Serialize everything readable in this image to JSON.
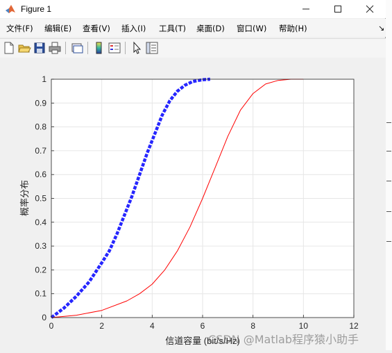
{
  "window": {
    "title": "Figure 1",
    "icon": "matlab-logo-icon"
  },
  "window_controls": {
    "minimize": "—",
    "maximize": "☐",
    "close": "✕"
  },
  "menu": {
    "items": [
      {
        "label": "文件(F)"
      },
      {
        "label": "编辑(E)"
      },
      {
        "label": "查看(V)"
      },
      {
        "label": "插入(I)"
      },
      {
        "label": "工具(T)"
      },
      {
        "label": "桌面(D)"
      },
      {
        "label": "窗口(W)"
      },
      {
        "label": "帮助(H)"
      }
    ],
    "overflow": "↘"
  },
  "toolbar": {
    "icons": [
      "new-figure-icon",
      "open-file-icon",
      "save-icon",
      "print-icon",
      "link-plot-icon",
      "colorbar-icon",
      "legend-icon",
      "pointer-icon",
      "property-editor-icon"
    ]
  },
  "colors": {
    "series_blue": "#0000ff",
    "series_red": "#ff0000",
    "grid": "#e6e6e6"
  },
  "chart_data": {
    "type": "line",
    "title": "",
    "xlabel": "信道容量 (bit/s/Hz)",
    "ylabel": "概率分布",
    "xlim": [
      0,
      12
    ],
    "ylim": [
      0,
      1
    ],
    "xticks": [
      0,
      2,
      4,
      6,
      8,
      10,
      12
    ],
    "yticks": [
      0,
      0.1,
      0.2,
      0.3,
      0.4,
      0.5,
      0.6,
      0.7,
      0.8,
      0.9,
      1
    ],
    "xtick_labels": [
      "0",
      "2",
      "4",
      "6",
      "8",
      "10",
      "12"
    ],
    "ytick_labels": [
      "0",
      "0.1",
      "0.2",
      "0.3",
      "0.4",
      "0.5",
      "0.6",
      "0.7",
      "0.8",
      "0.9",
      "1"
    ],
    "grid": true,
    "series": [
      {
        "color": "#0000ff",
        "style": "thick-dashed",
        "x": [
          0,
          0.5,
          1.0,
          1.5,
          2.0,
          2.3,
          2.6,
          2.9,
          3.2,
          3.5,
          3.8,
          4.1,
          4.4,
          4.7,
          5.0,
          5.3,
          5.6,
          6.0,
          6.3
        ],
        "y": [
          0,
          0.04,
          0.09,
          0.15,
          0.23,
          0.28,
          0.35,
          0.43,
          0.51,
          0.6,
          0.69,
          0.77,
          0.85,
          0.91,
          0.95,
          0.975,
          0.99,
          0.998,
          1.0
        ]
      },
      {
        "color": "#ff0000",
        "style": "thin-solid",
        "x": [
          0,
          1,
          2,
          3,
          3.5,
          4.0,
          4.5,
          5.0,
          5.5,
          6.0,
          6.5,
          7.0,
          7.5,
          8.0,
          8.5,
          9.0,
          9.5,
          10.0
        ],
        "y": [
          0,
          0.01,
          0.03,
          0.07,
          0.1,
          0.14,
          0.2,
          0.28,
          0.38,
          0.5,
          0.63,
          0.76,
          0.87,
          0.94,
          0.98,
          0.995,
          1.0,
          1.0
        ]
      }
    ]
  },
  "watermark": "CSDN @Matlab程序猿小助手"
}
